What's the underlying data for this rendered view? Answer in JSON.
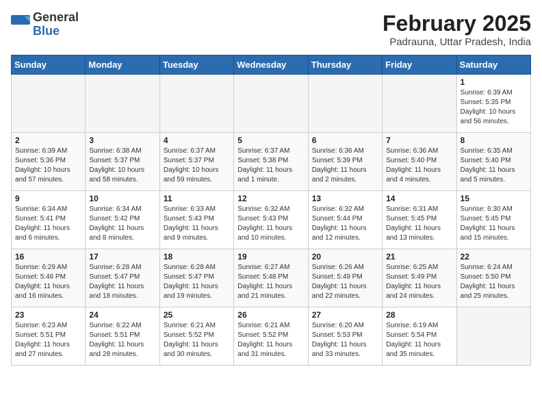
{
  "header": {
    "logo_general": "General",
    "logo_blue": "Blue",
    "title": "February 2025",
    "subtitle": "Padrauna, Uttar Pradesh, India"
  },
  "weekdays": [
    "Sunday",
    "Monday",
    "Tuesday",
    "Wednesday",
    "Thursday",
    "Friday",
    "Saturday"
  ],
  "weeks": [
    [
      {
        "day": "",
        "info": ""
      },
      {
        "day": "",
        "info": ""
      },
      {
        "day": "",
        "info": ""
      },
      {
        "day": "",
        "info": ""
      },
      {
        "day": "",
        "info": ""
      },
      {
        "day": "",
        "info": ""
      },
      {
        "day": "1",
        "info": "Sunrise: 6:39 AM\nSunset: 5:35 PM\nDaylight: 10 hours\nand 56 minutes."
      }
    ],
    [
      {
        "day": "2",
        "info": "Sunrise: 6:39 AM\nSunset: 5:36 PM\nDaylight: 10 hours\nand 57 minutes."
      },
      {
        "day": "3",
        "info": "Sunrise: 6:38 AM\nSunset: 5:37 PM\nDaylight: 10 hours\nand 58 minutes."
      },
      {
        "day": "4",
        "info": "Sunrise: 6:37 AM\nSunset: 5:37 PM\nDaylight: 10 hours\nand 59 minutes."
      },
      {
        "day": "5",
        "info": "Sunrise: 6:37 AM\nSunset: 5:38 PM\nDaylight: 11 hours\nand 1 minute."
      },
      {
        "day": "6",
        "info": "Sunrise: 6:36 AM\nSunset: 5:39 PM\nDaylight: 11 hours\nand 2 minutes."
      },
      {
        "day": "7",
        "info": "Sunrise: 6:36 AM\nSunset: 5:40 PM\nDaylight: 11 hours\nand 4 minutes."
      },
      {
        "day": "8",
        "info": "Sunrise: 6:35 AM\nSunset: 5:40 PM\nDaylight: 11 hours\nand 5 minutes."
      }
    ],
    [
      {
        "day": "9",
        "info": "Sunrise: 6:34 AM\nSunset: 5:41 PM\nDaylight: 11 hours\nand 6 minutes."
      },
      {
        "day": "10",
        "info": "Sunrise: 6:34 AM\nSunset: 5:42 PM\nDaylight: 11 hours\nand 8 minutes."
      },
      {
        "day": "11",
        "info": "Sunrise: 6:33 AM\nSunset: 5:43 PM\nDaylight: 11 hours\nand 9 minutes."
      },
      {
        "day": "12",
        "info": "Sunrise: 6:32 AM\nSunset: 5:43 PM\nDaylight: 11 hours\nand 10 minutes."
      },
      {
        "day": "13",
        "info": "Sunrise: 6:32 AM\nSunset: 5:44 PM\nDaylight: 11 hours\nand 12 minutes."
      },
      {
        "day": "14",
        "info": "Sunrise: 6:31 AM\nSunset: 5:45 PM\nDaylight: 11 hours\nand 13 minutes."
      },
      {
        "day": "15",
        "info": "Sunrise: 6:30 AM\nSunset: 5:45 PM\nDaylight: 11 hours\nand 15 minutes."
      }
    ],
    [
      {
        "day": "16",
        "info": "Sunrise: 6:29 AM\nSunset: 5:46 PM\nDaylight: 11 hours\nand 16 minutes."
      },
      {
        "day": "17",
        "info": "Sunrise: 6:28 AM\nSunset: 5:47 PM\nDaylight: 11 hours\nand 18 minutes."
      },
      {
        "day": "18",
        "info": "Sunrise: 6:28 AM\nSunset: 5:47 PM\nDaylight: 11 hours\nand 19 minutes."
      },
      {
        "day": "19",
        "info": "Sunrise: 6:27 AM\nSunset: 5:48 PM\nDaylight: 11 hours\nand 21 minutes."
      },
      {
        "day": "20",
        "info": "Sunrise: 6:26 AM\nSunset: 5:49 PM\nDaylight: 11 hours\nand 22 minutes."
      },
      {
        "day": "21",
        "info": "Sunrise: 6:25 AM\nSunset: 5:49 PM\nDaylight: 11 hours\nand 24 minutes."
      },
      {
        "day": "22",
        "info": "Sunrise: 6:24 AM\nSunset: 5:50 PM\nDaylight: 11 hours\nand 25 minutes."
      }
    ],
    [
      {
        "day": "23",
        "info": "Sunrise: 6:23 AM\nSunset: 5:51 PM\nDaylight: 11 hours\nand 27 minutes."
      },
      {
        "day": "24",
        "info": "Sunrise: 6:22 AM\nSunset: 5:51 PM\nDaylight: 11 hours\nand 28 minutes."
      },
      {
        "day": "25",
        "info": "Sunrise: 6:21 AM\nSunset: 5:52 PM\nDaylight: 11 hours\nand 30 minutes."
      },
      {
        "day": "26",
        "info": "Sunrise: 6:21 AM\nSunset: 5:52 PM\nDaylight: 11 hours\nand 31 minutes."
      },
      {
        "day": "27",
        "info": "Sunrise: 6:20 AM\nSunset: 5:53 PM\nDaylight: 11 hours\nand 33 minutes."
      },
      {
        "day": "28",
        "info": "Sunrise: 6:19 AM\nSunset: 5:54 PM\nDaylight: 11 hours\nand 35 minutes."
      },
      {
        "day": "",
        "info": ""
      }
    ]
  ]
}
